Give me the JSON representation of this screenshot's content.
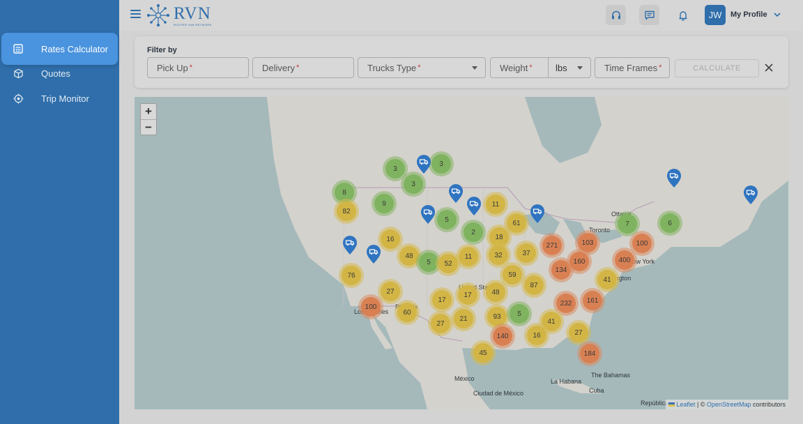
{
  "sidebar": {
    "items": [
      {
        "label": "Rates Calculator",
        "icon": "calculator-icon",
        "active": true
      },
      {
        "label": "Quotes",
        "icon": "box-icon",
        "active": false
      },
      {
        "label": "Trip Monitor",
        "icon": "location-target-icon",
        "active": false
      }
    ]
  },
  "header": {
    "logo_text": "RVN",
    "logo_subtitle": "ROUTER VAN NETWORK",
    "avatar_initials": "JW",
    "profile_label": "My Profile"
  },
  "filter": {
    "title": "Filter by",
    "pickup_label": "Pick Up",
    "delivery_label": "Delivery",
    "trucks_label": "Trucks Type",
    "weight_label": "Weight",
    "unit_value": "lbs",
    "timeframes_label": "Time Frames",
    "required_mark": "*",
    "calculate_label": "CALCULATE"
  },
  "map": {
    "zoom_in": "+",
    "zoom_out": "−",
    "attribution_leaflet": "Leaflet",
    "attribution_sep": " | © ",
    "attribution_osm": "OpenStreetMap",
    "attribution_tail": " contributors",
    "cities": [
      "Ottawa",
      "Toronto",
      "New York",
      "Washington",
      "United States",
      "Los Angeles",
      "Phoenix",
      "México",
      "Ciudad de México",
      "La Habana",
      "The Bahamas",
      "Cuba",
      "República"
    ],
    "clusters": [
      "3",
      "3",
      "3",
      "8",
      "9",
      "82",
      "11",
      "5",
      "61",
      "2",
      "18",
      "16",
      "7",
      "6",
      "271",
      "103",
      "100",
      "48",
      "5",
      "52",
      "11",
      "32",
      "37",
      "400",
      "134",
      "160",
      "76",
      "59",
      "87",
      "41",
      "27",
      "17",
      "17",
      "48",
      "232",
      "161",
      "100",
      "60",
      "93",
      "5",
      "27",
      "21",
      "41",
      "140",
      "16",
      "27",
      "45",
      "184"
    ]
  },
  "colors": {
    "sidebar": "#2f6eaa",
    "active_item": "#4a93de",
    "cluster_green": "#7fb35f",
    "cluster_yellow": "#d2b545",
    "cluster_orange": "#d98053",
    "pin": "#2f74c0"
  }
}
